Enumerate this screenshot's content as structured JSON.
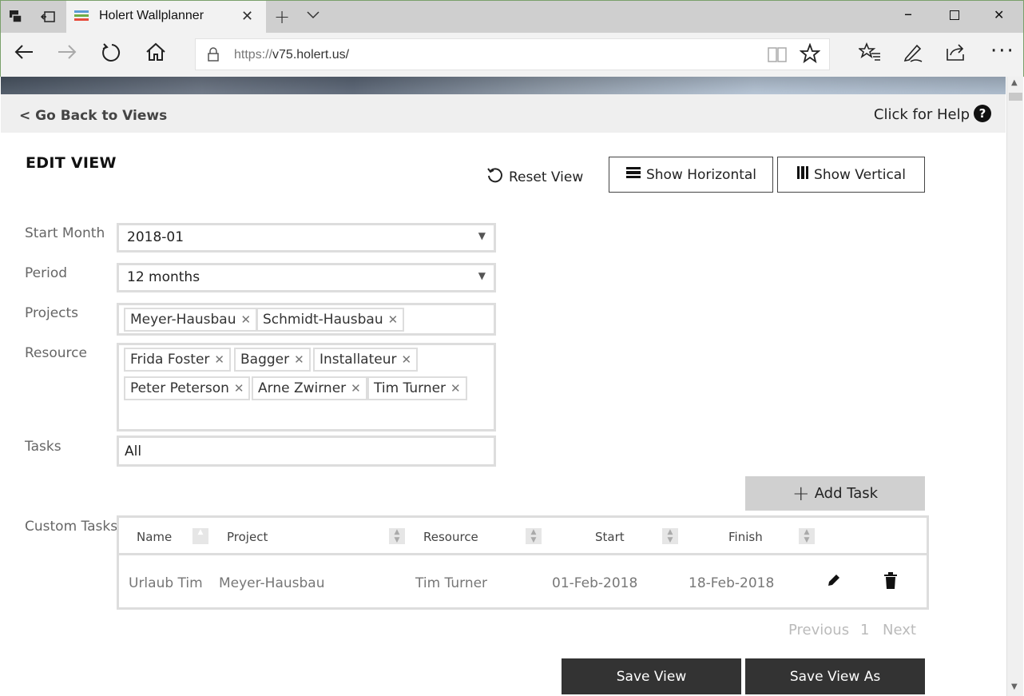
{
  "browser": {
    "tab_title": "Holert Wallplanner",
    "url_scheme": "https://",
    "url_rest": "v75.holert.us/"
  },
  "header": {
    "back_link": "< Go Back to Views",
    "help_link": "Click for Help",
    "help_icon": "?"
  },
  "edit": {
    "title": "EDIT VIEW",
    "reset_label": "Reset View",
    "show_horizontal": "Show Horizontal",
    "show_vertical": "Show Vertical"
  },
  "form": {
    "start_month_label": "Start Month",
    "start_month_value": "2018-01",
    "period_label": "Period",
    "period_value": "12 months",
    "projects_label": "Projects",
    "projects": [
      "Meyer-Hausbau",
      "Schmidt-Hausbau"
    ],
    "resource_label": "Resource",
    "resources": [
      "Frida Foster",
      "Bagger",
      "Installateur",
      "Peter Peterson",
      "Arne Zwirner",
      "Tim Turner"
    ],
    "tasks_label": "Tasks",
    "tasks_value": "All"
  },
  "custom_tasks": {
    "label": "Custom Tasks",
    "add_button": "Add Task",
    "columns": [
      "Name",
      "Project",
      "Resource",
      "Start",
      "Finish"
    ],
    "rows": [
      [
        "Urlaub Tim",
        "Meyer-Hausbau",
        "Tim Turner",
        "01-Feb-2018",
        "18-Feb-2018"
      ]
    ]
  },
  "pager": {
    "previous": "Previous",
    "page": "1",
    "next": "Next"
  },
  "footer": {
    "save_view": "Save View",
    "save_view_as": "Save View As"
  }
}
